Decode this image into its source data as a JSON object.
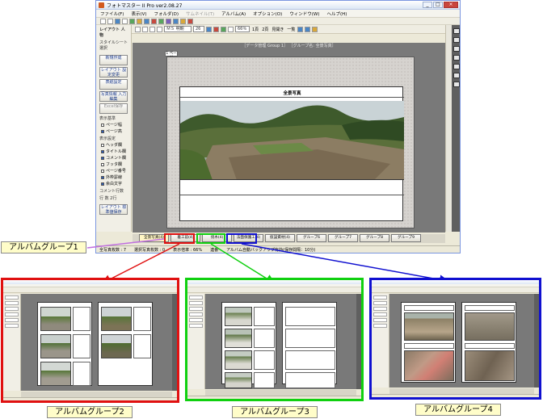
{
  "main_window": {
    "title": "フォトマスター II Pro ver2.08.27",
    "window_buttons": [
      "_",
      "□",
      "×"
    ],
    "menu": [
      {
        "label": "ファイル(F)",
        "enabled": true
      },
      {
        "label": "表示(V)",
        "enabled": true
      },
      {
        "label": "フォルダ(D)",
        "enabled": true
      },
      {
        "label": "サムネイル(T)",
        "enabled": false
      },
      {
        "label": "アルバム(A)",
        "enabled": true
      },
      {
        "label": "オプション(O)",
        "enabled": true
      },
      {
        "label": "ウィンドウ(W)",
        "enabled": true
      },
      {
        "label": "ヘルプ(H)",
        "enabled": true
      }
    ],
    "toolbar2": {
      "font_combo": "ＭＳ 明朝",
      "size_combo": "26",
      "zoom_combo": "66％",
      "buttons": [
        "1頁",
        "2頁",
        "見開き",
        "一覧"
      ]
    },
    "side_panel": {
      "header": "レイアウト 人物",
      "top_label": "スタイルシート選択",
      "buttons": [
        "新規作成",
        "レイアウト 設定変更",
        "表紙設定",
        "写真情報 入力編集",
        "Excel保存"
      ],
      "view_label": "表示基準",
      "view_options": [
        {
          "label": "ページ幅",
          "checked": false
        },
        {
          "label": "ページ高",
          "checked": true
        }
      ],
      "display_label": "表示設定",
      "display_options": [
        {
          "label": "ヘッダ欄",
          "checked": false
        },
        {
          "label": "タイトル欄",
          "checked": true
        },
        {
          "label": "コメント欄",
          "checked": true
        },
        {
          "label": "フッタ欄",
          "checked": false
        },
        {
          "label": "ページ番号",
          "checked": false
        },
        {
          "label": "外枠罫線",
          "checked": true
        },
        {
          "label": "余白文字",
          "checked": true
        }
      ],
      "comment_label": "コメント行数",
      "comment_value": "行 数 2行",
      "bottom_button": "レイアウト 標準値保存"
    },
    "workspace": {
      "header": "［データ管理 Group 1］ ［グループ名: 全景写真］",
      "page_tag": "1 ページ",
      "sheet_title": "全景写真"
    },
    "tabs": [
      {
        "label": "全景写真(4)",
        "active": true
      },
      {
        "label": "着工前(4)",
        "active": false
      },
      {
        "label": "伐木(4)",
        "active": false
      },
      {
        "label": "法面保護工(4)",
        "active": false
      },
      {
        "label": "仮設資材(4)",
        "active": false
      },
      {
        "label": "グループ6",
        "active": false
      },
      {
        "label": "グループ7",
        "active": false
      },
      {
        "label": "グループ8",
        "active": false
      },
      {
        "label": "グループ9",
        "active": false
      },
      {
        "label": "グループ10",
        "active": false
      }
    ],
    "status": [
      "全写真枚数 : 7",
      "選択写真枚数 : 0",
      "表示倍率 : 66%",
      "連番",
      "アルバム自動バックアップ有効(保存間隔：10分)"
    ]
  },
  "labels": {
    "group1": "アルバムグループ1",
    "group2": "アルバムグループ2",
    "group3": "アルバムグループ3",
    "group4": "アルバムグループ4"
  },
  "colors": {
    "group2": "#e01010",
    "group3": "#10d010",
    "group4": "#1010d0",
    "group1_arrow": "#c070e0",
    "label_bg": "#fffdc9"
  }
}
